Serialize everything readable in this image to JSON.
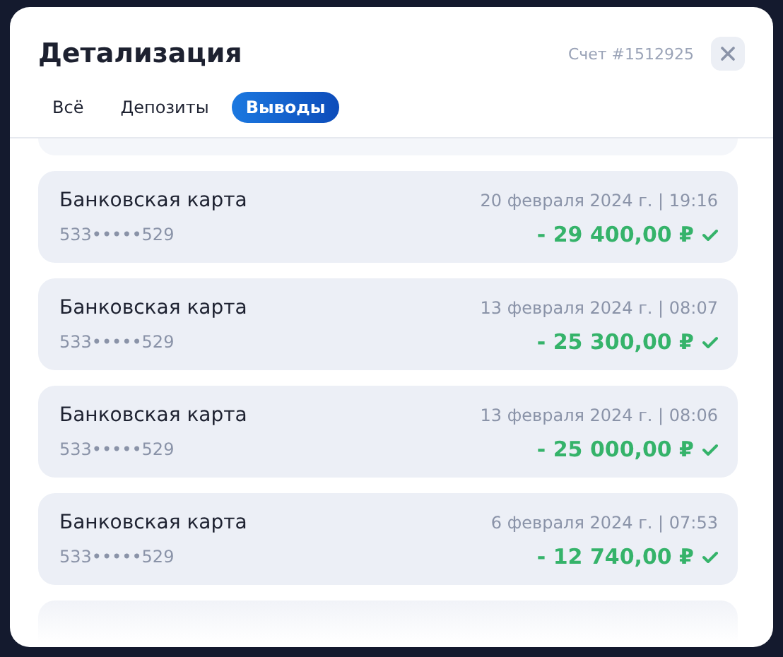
{
  "window": {
    "title": "Детализация",
    "account": "Счет #1512925"
  },
  "tabs": [
    {
      "label": "Всё",
      "selected": false
    },
    {
      "label": "Депозиты",
      "selected": false
    },
    {
      "label": "Выводы",
      "selected": true
    }
  ],
  "transactions": [
    {
      "method": "Банковская карта",
      "card": "533•••••529",
      "date": "20 февраля 2024 г. | 19:16",
      "amount": "- 29 400,00 ₽",
      "completed": true
    },
    {
      "method": "Банковская карта",
      "card": "533•••••529",
      "date": "13 февраля 2024 г. | 08:07",
      "amount": "- 25 300,00 ₽",
      "completed": true
    },
    {
      "method": "Банковская карта",
      "card": "533•••••529",
      "date": "13 февраля 2024 г. | 08:06",
      "amount": "- 25 000,00 ₽",
      "completed": true
    },
    {
      "method": "Банковская карта",
      "card": "533•••••529",
      "date": "6 февраля 2024 г. | 07:53",
      "amount": "- 12 740,00 ₽",
      "completed": true
    }
  ]
}
